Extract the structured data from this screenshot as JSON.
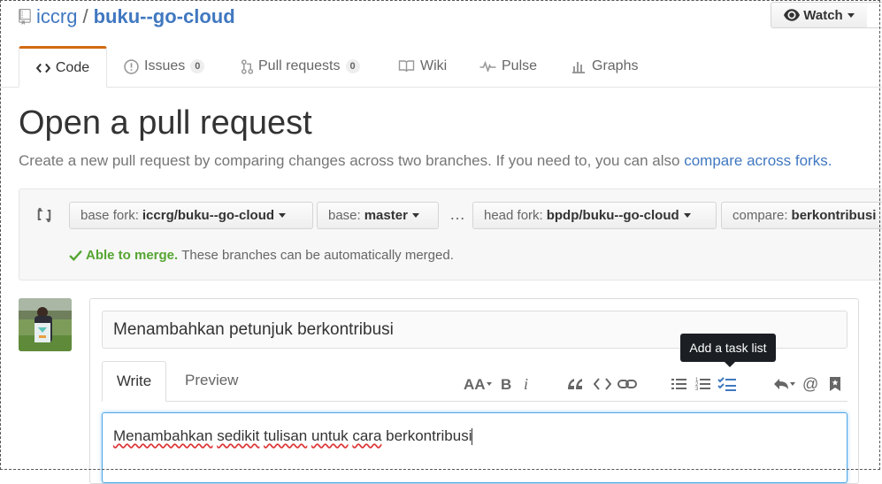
{
  "repo": {
    "owner": "iccrg",
    "separator": "/",
    "name": "buku--go-cloud"
  },
  "watch": {
    "label": "Watch"
  },
  "tabs": [
    {
      "label": "Code"
    },
    {
      "label": "Issues",
      "count": "0"
    },
    {
      "label": "Pull requests",
      "count": "0"
    },
    {
      "label": "Wiki"
    },
    {
      "label": "Pulse"
    },
    {
      "label": "Graphs"
    }
  ],
  "page": {
    "title": "Open a pull request",
    "subtitle": "Create a new pull request by comparing changes across two branches. If you need to, you can also ",
    "subtitle_link": "compare across forks."
  },
  "compare": {
    "base_fork_label": "base fork:",
    "base_fork_value": "iccrg/buku--go-cloud",
    "base_label": "base:",
    "base_value": "master",
    "ellipsis": "…",
    "head_fork_label": "head fork:",
    "head_fork_value": "bpdp/buku--go-cloud",
    "compare_label": "compare:",
    "compare_value": "berkontribusi",
    "merge_ok": "Able to merge.",
    "merge_text": "These branches can be automatically merged."
  },
  "editor": {
    "title_value": "Menambahkan petunjuk berkontribusi",
    "write_tab": "Write",
    "preview_tab": "Preview",
    "tooltip": "Add a task list",
    "body_words": [
      "Menambahkan",
      "sedikit",
      "tulisan",
      "untuk",
      "cara",
      "berkontribusi"
    ]
  },
  "toolbar_icons": [
    "text-size-icon",
    "bold-icon",
    "italic-icon",
    "quote-icon",
    "code-icon",
    "link-icon",
    "unordered-list-icon",
    "ordered-list-icon",
    "task-list-icon",
    "reply-icon",
    "mention-icon",
    "bookmark-icon"
  ],
  "colors": {
    "link": "#4078c0",
    "tab_accent": "#d26911",
    "merge_ok": "#55a532",
    "tooltip_bg": "#1b1f23",
    "focus": "#51a7e8"
  }
}
